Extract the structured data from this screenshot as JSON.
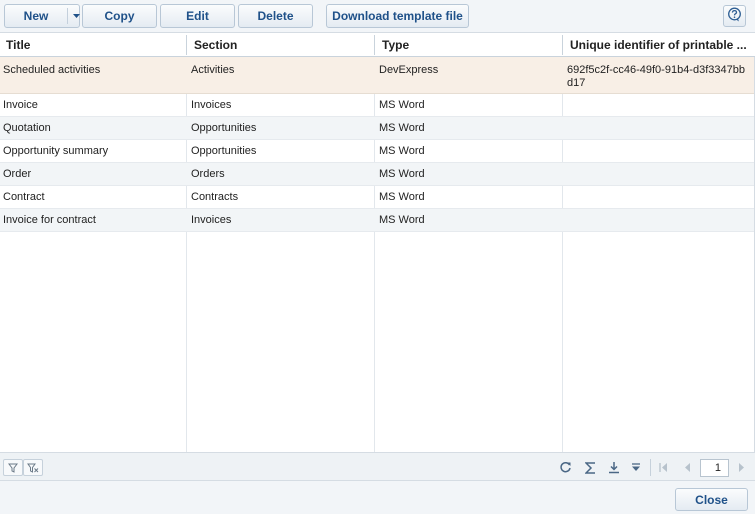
{
  "toolbar": {
    "new_label": "New",
    "copy_label": "Copy",
    "edit_label": "Edit",
    "delete_label": "Delete",
    "download_label": "Download template file",
    "new_dropdown_icon": "caret-down-icon",
    "help_icon": "help-icon"
  },
  "columns": {
    "title": "Title",
    "section": "Section",
    "type": "Type",
    "uid": "Unique identifier of printable ..."
  },
  "rows": [
    {
      "title": "Scheduled activities",
      "section": "Activities",
      "type": "DevExpress",
      "uid": "692f5c2f-cc46-49f0-91b4-d3f3347bbd17",
      "selected": true
    },
    {
      "title": "Invoice",
      "section": "Invoices",
      "type": "MS Word",
      "uid": ""
    },
    {
      "title": "Quotation",
      "section": "Opportunities",
      "type": "MS Word",
      "uid": ""
    },
    {
      "title": "Opportunity summary",
      "section": "Opportunities",
      "type": "MS Word",
      "uid": ""
    },
    {
      "title": "Order",
      "section": "Orders",
      "type": "MS Word",
      "uid": ""
    },
    {
      "title": "Contract",
      "section": "Contracts",
      "type": "MS Word",
      "uid": ""
    },
    {
      "title": "Invoice for contract",
      "section": "Invoices",
      "type": "MS Word",
      "uid": ""
    }
  ],
  "footer": {
    "page_number": "1",
    "icons": [
      "filter-icon",
      "clear-filter-icon",
      "refresh-icon",
      "sum-icon",
      "export-icon",
      "menu-down-icon",
      "first-page-icon",
      "previous-page-icon",
      "next-page-icon"
    ]
  },
  "dialog": {
    "close_label": "Close"
  },
  "colors": {
    "accent_text": "#1f5189",
    "selected_row": "#f8efe6",
    "alt_row": "#f2f5f7"
  }
}
